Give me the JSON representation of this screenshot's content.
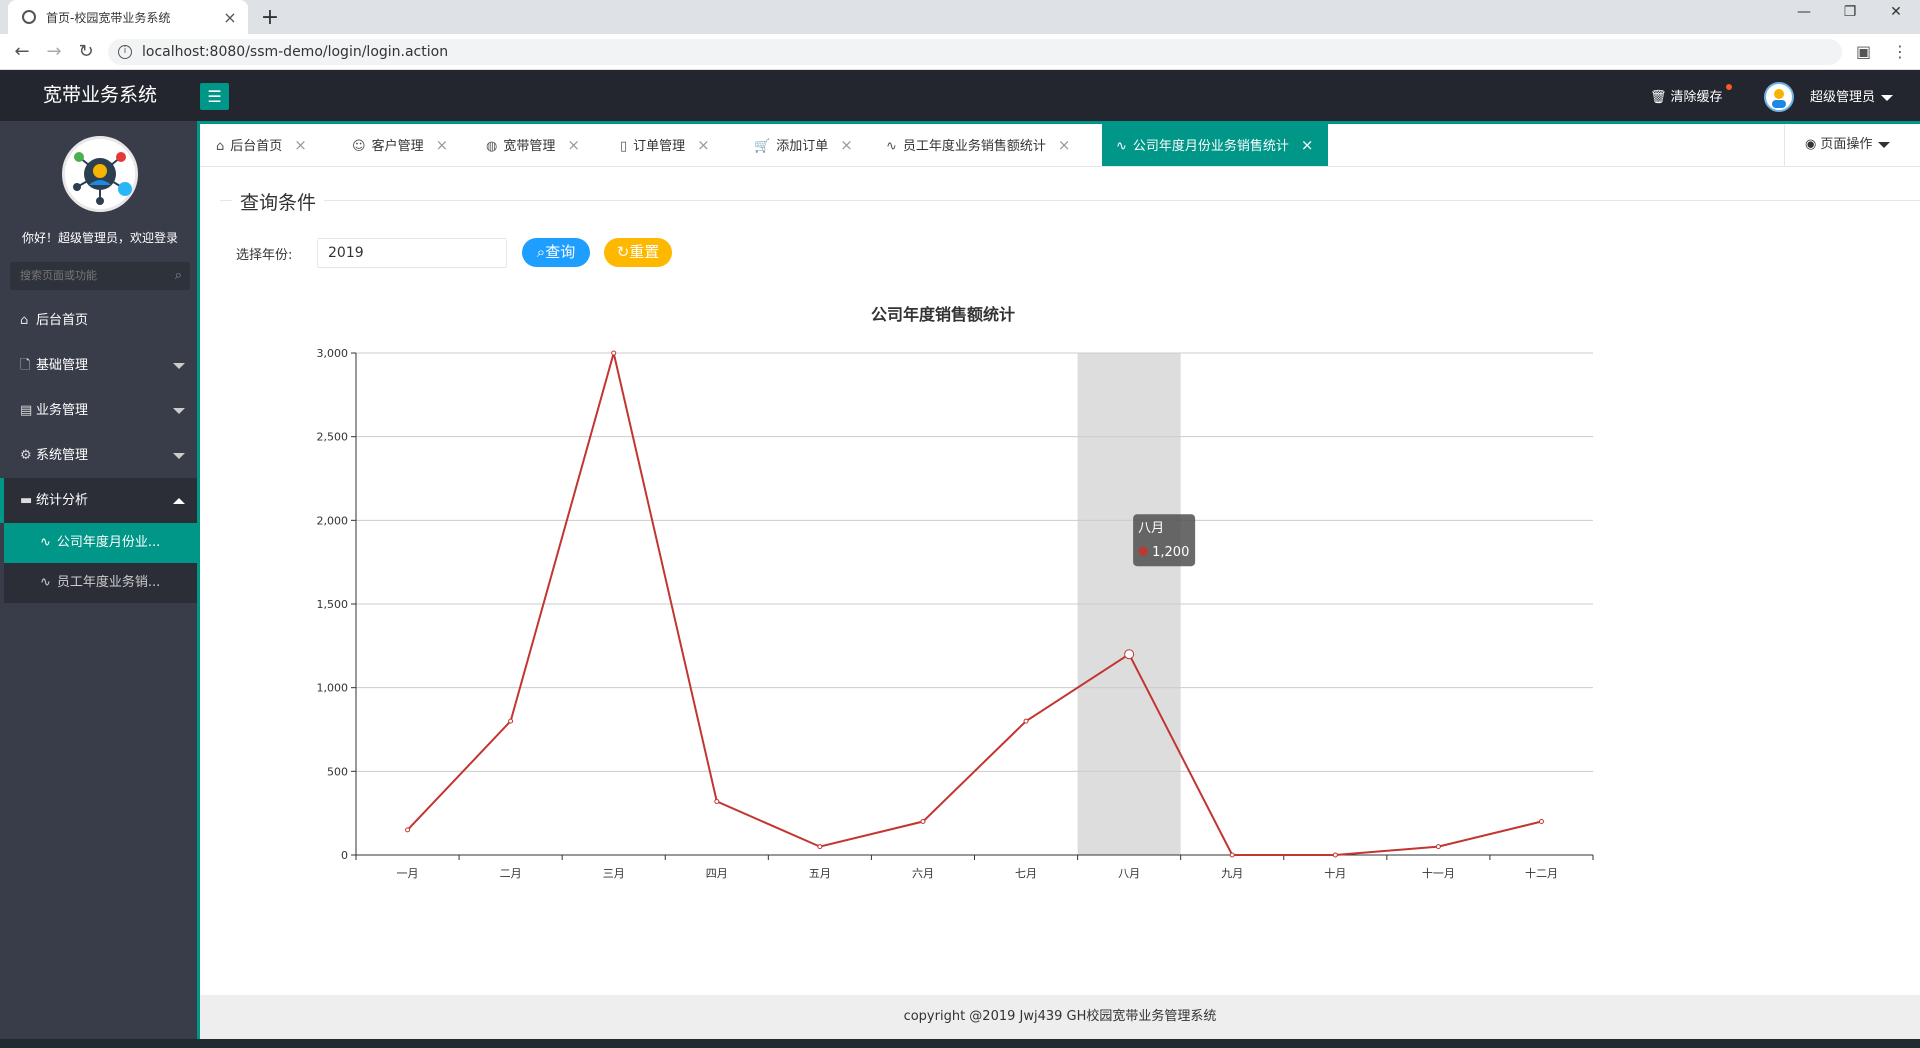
{
  "browser": {
    "tab_title": "首页-校园宽带业务系统",
    "url": "localhost:8080/ssm-demo/login/login.action"
  },
  "header": {
    "logo": "宽带业务系统",
    "clear_cache": "清除缓存",
    "user": "超级管理员"
  },
  "sidebar": {
    "welcome": "你好！超级管理员，欢迎登录",
    "search_placeholder": "搜索页面或功能",
    "items": [
      {
        "label": "后台首页",
        "icon": "home-icon"
      },
      {
        "label": "基础管理",
        "icon": "file-icon"
      },
      {
        "label": "业务管理",
        "icon": "list-icon"
      },
      {
        "label": "系统管理",
        "icon": "gear-icon"
      },
      {
        "label": "统计分析",
        "icon": "chat-icon"
      }
    ],
    "sub_items": [
      {
        "label": "公司年度月份业...",
        "icon": "pulse-icon",
        "active": true
      },
      {
        "label": "员工年度业务销...",
        "icon": "pulse-icon",
        "active": false
      }
    ]
  },
  "tabs": [
    {
      "label": "后台首页",
      "icon": "home-icon"
    },
    {
      "label": "客户管理",
      "icon": "user-icon"
    },
    {
      "label": "宽带管理",
      "icon": "globe-icon"
    },
    {
      "label": "订单管理",
      "icon": "clipboard-icon"
    },
    {
      "label": "添加订单",
      "icon": "cart-icon"
    },
    {
      "label": "员工年度业务销售额统计",
      "icon": "pulse-icon"
    },
    {
      "label": "公司年度月份业务销售统计",
      "icon": "pulse-icon",
      "active": true
    }
  ],
  "page_ops": "页面操作",
  "query": {
    "legend": "查询条件",
    "year_label": "选择年份:",
    "year_value": "2019",
    "query_button": "查询",
    "reset_button": "重置"
  },
  "chart_data": {
    "type": "line",
    "title": "公司年度销售额统计",
    "categories": [
      "一月",
      "二月",
      "三月",
      "四月",
      "五月",
      "六月",
      "七月",
      "八月",
      "九月",
      "十月",
      "十一月",
      "十二月"
    ],
    "values": [
      150,
      800,
      3000,
      320,
      50,
      200,
      800,
      1200,
      0,
      0,
      50,
      200
    ],
    "y_ticks": [
      "0",
      "500",
      "1,000",
      "1,500",
      "2,000",
      "2,500",
      "3,000"
    ],
    "ylim": [
      0,
      3000
    ],
    "grid": true,
    "line_color": "#c23531",
    "highlight_color": "#dddddd",
    "tooltip": {
      "category": "八月",
      "value": "1,200"
    }
  },
  "footer": "copyright @2019 Jwj439 GH校园宽带业务管理系统"
}
